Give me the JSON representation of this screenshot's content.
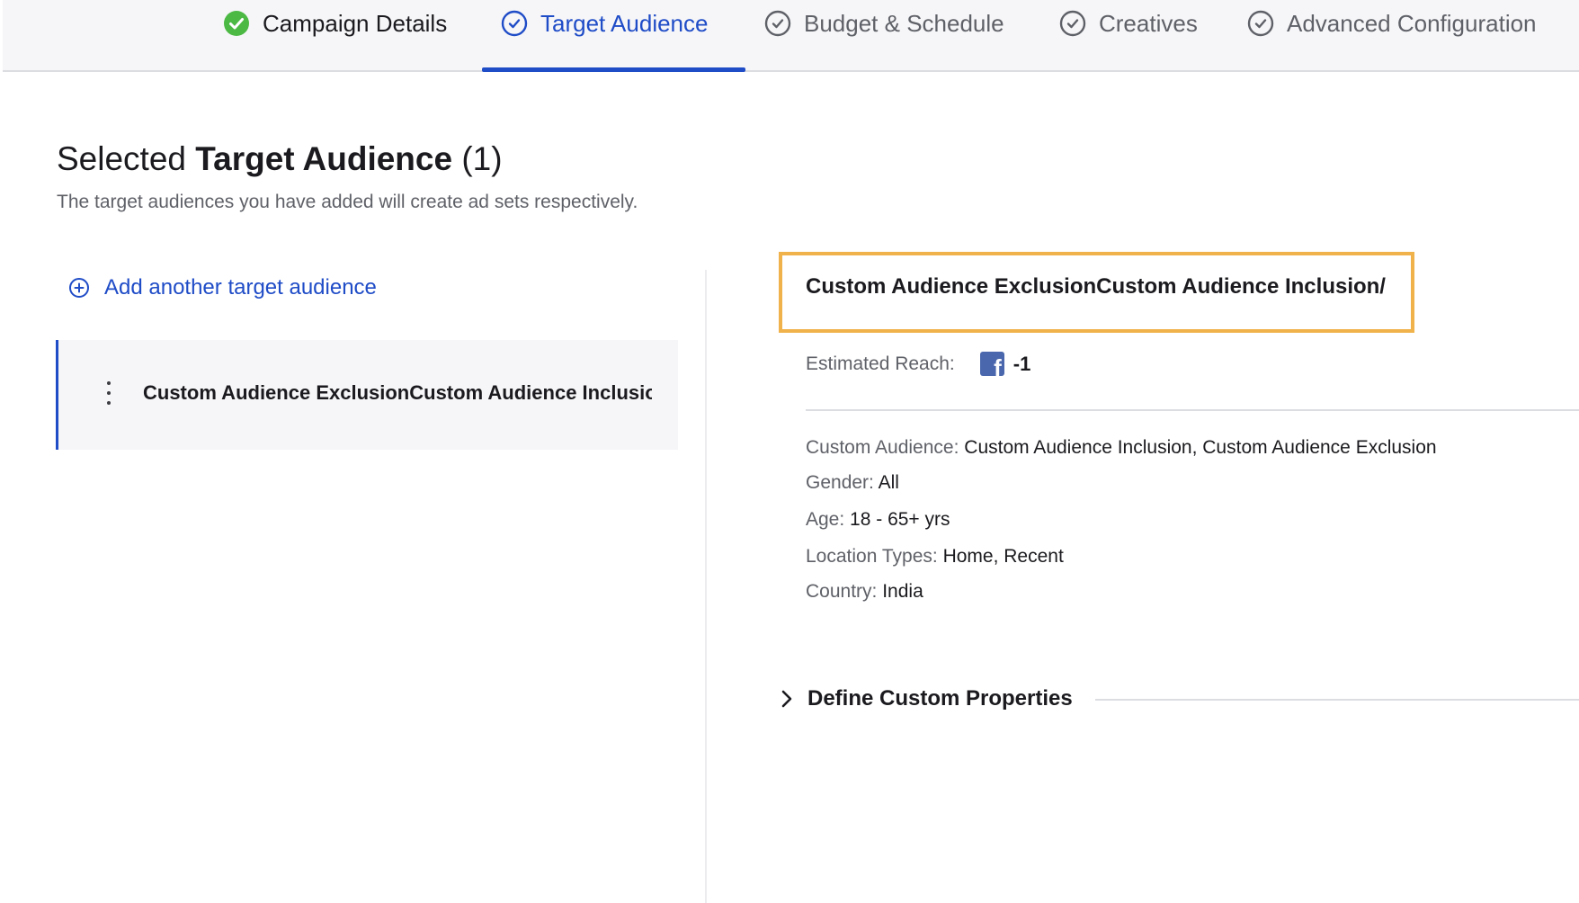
{
  "steps": [
    {
      "label": "Campaign Details",
      "state": "done",
      "icon": "check-circle-filled-icon"
    },
    {
      "label": "Target Audience",
      "state": "active",
      "icon": "check-circle-outline-icon"
    },
    {
      "label": "Budget & Schedule",
      "state": "pending",
      "icon": "check-circle-outline-icon"
    },
    {
      "label": "Creatives",
      "state": "pending",
      "icon": "check-circle-outline-icon"
    },
    {
      "label": "Advanced Configuration",
      "state": "pending",
      "icon": "check-circle-outline-icon"
    }
  ],
  "heading": {
    "prefix": "Selected ",
    "bold": "Target Audience",
    "count": " (1)",
    "subtitle": "The target audiences you have added will create ad sets respectively."
  },
  "left": {
    "add_label": "Add another target audience",
    "audiences": [
      {
        "name": "Custom Audience ExclusionCustom Audience Inclusion/"
      }
    ]
  },
  "detail": {
    "title": "Custom Audience ExclusionCustom Audience Inclusion/",
    "reach_label": "Estimated Reach:",
    "reach_value": "-1",
    "properties": [
      {
        "key": "Custom Audience:",
        "value": "Custom Audience Inclusion, Custom Audience Exclusion"
      },
      {
        "key": "Gender:",
        "value": "All"
      },
      {
        "key": "Age:",
        "value": "18 - 65+ yrs"
      },
      {
        "key": "Location Types:",
        "value": "Home, Recent"
      },
      {
        "key": "Country:",
        "value": "India"
      }
    ],
    "custom_props_label": "Define Custom Properties"
  },
  "colors": {
    "accent": "#1f4cc7",
    "success": "#4cb944",
    "highlight_border": "#f0b24a",
    "facebook": "#4a67ad"
  }
}
